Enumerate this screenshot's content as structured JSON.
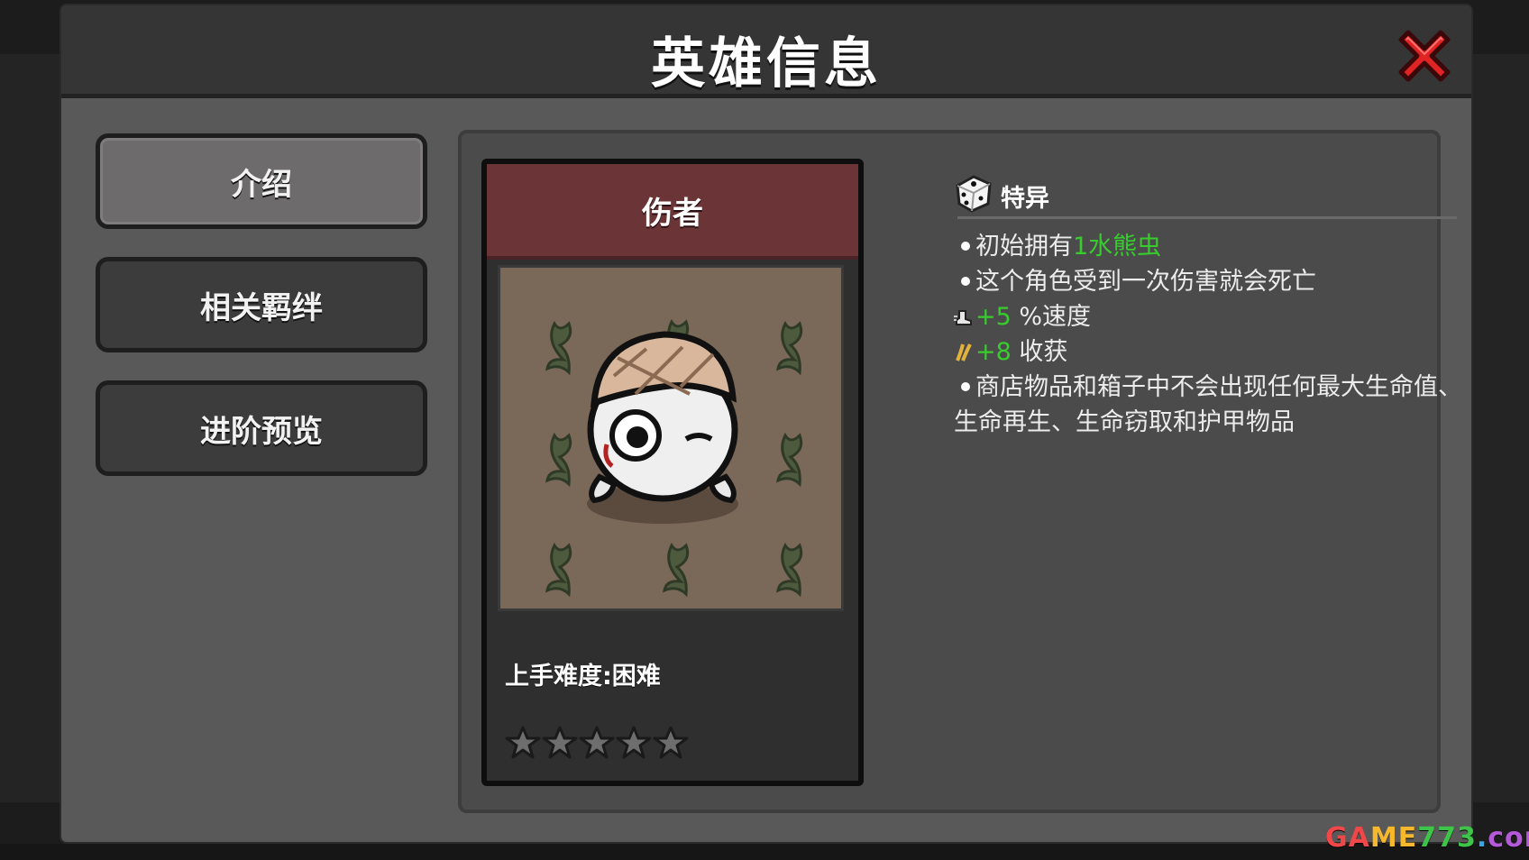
{
  "window": {
    "title": "英雄信息",
    "close_icon": "close-x-icon"
  },
  "tabs": [
    {
      "label": "介绍",
      "active": true
    },
    {
      "label": "相关羁绊",
      "active": false
    },
    {
      "label": "进阶预览",
      "active": false
    }
  ],
  "hero": {
    "name": "伤者",
    "portrait_icon": "bandaged-hero-portrait",
    "difficulty": "上手难度:困难",
    "stars_total": 5,
    "stars_filled": 0
  },
  "traits": {
    "icon": "dice-icon",
    "title": "特异",
    "items": [
      {
        "prefix": "初始拥有",
        "highlight": "1水熊虫"
      },
      {
        "text": "这个角色受到一次伤害就会死亡"
      },
      {
        "icon": "speed-boot-icon",
        "value": "+5",
        "suffix": " %速度"
      },
      {
        "icon": "harvest-icon",
        "value": "+8",
        "suffix": " 收获"
      },
      {
        "text": "商店物品和箱子中不会出现任何最大生命值、生命再生、生命窃取和护甲物品"
      }
    ]
  },
  "watermark": {
    "p1": "GA",
    "p2": "ME",
    "p3": "773",
    "p4": ".",
    "p5": "com"
  },
  "colors": {
    "highlight_green": "#38cc2e",
    "card_header": "#6b3538",
    "close_red": "#e02424"
  }
}
